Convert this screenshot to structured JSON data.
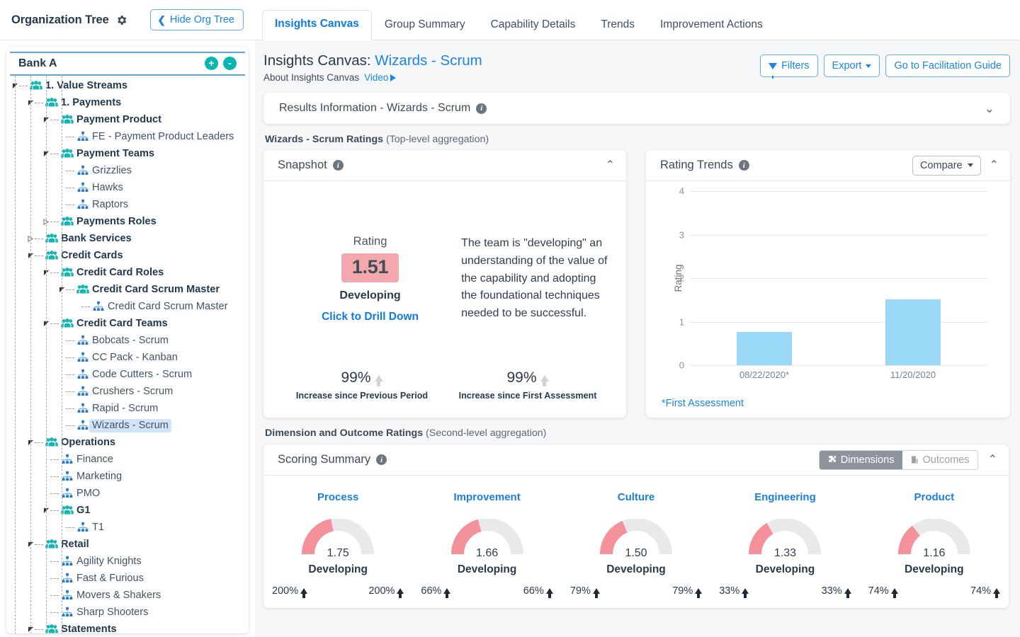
{
  "org_panel": {
    "title": "Organization Tree",
    "gear_icon": "gear-icon",
    "hide_button": "Hide Org Tree",
    "root": "Bank A",
    "expand_all": "+",
    "collapse_all": "-",
    "nodes": [
      {
        "label": "1. Value Streams",
        "depth": 1,
        "type": "group",
        "expanded": true,
        "selected": false
      },
      {
        "label": "1. Payments",
        "depth": 2,
        "type": "group",
        "expanded": true,
        "selected": false
      },
      {
        "label": "Payment Product",
        "depth": 3,
        "type": "group",
        "expanded": true,
        "selected": false
      },
      {
        "label": "FE - Payment Product Leaders",
        "depth": 4,
        "type": "team",
        "expanded": null,
        "selected": false
      },
      {
        "label": "Payment Teams",
        "depth": 3,
        "type": "group",
        "expanded": true,
        "selected": false
      },
      {
        "label": "Grizzlies",
        "depth": 4,
        "type": "team",
        "expanded": null,
        "selected": false
      },
      {
        "label": "Hawks",
        "depth": 4,
        "type": "team",
        "expanded": null,
        "selected": false
      },
      {
        "label": "Raptors",
        "depth": 4,
        "type": "team",
        "expanded": null,
        "selected": false
      },
      {
        "label": "Payments Roles",
        "depth": 3,
        "type": "group",
        "expanded": false,
        "selected": false
      },
      {
        "label": "Bank Services",
        "depth": 2,
        "type": "group",
        "expanded": false,
        "selected": false
      },
      {
        "label": "Credit Cards",
        "depth": 2,
        "type": "group",
        "expanded": true,
        "selected": false
      },
      {
        "label": "Credit Card Roles",
        "depth": 3,
        "type": "group",
        "expanded": true,
        "selected": false
      },
      {
        "label": "Credit Card Scrum Master",
        "depth": 4,
        "type": "group",
        "expanded": true,
        "selected": false
      },
      {
        "label": "Credit Card Scrum Master",
        "depth": 5,
        "type": "team",
        "expanded": null,
        "selected": false
      },
      {
        "label": "Credit Card Teams",
        "depth": 3,
        "type": "group",
        "expanded": true,
        "selected": false
      },
      {
        "label": "Bobcats - Scrum",
        "depth": 4,
        "type": "team",
        "expanded": null,
        "selected": false
      },
      {
        "label": "CC Pack - Kanban",
        "depth": 4,
        "type": "team",
        "expanded": null,
        "selected": false
      },
      {
        "label": "Code Cutters - Scrum",
        "depth": 4,
        "type": "team",
        "expanded": null,
        "selected": false
      },
      {
        "label": "Crushers - Scrum",
        "depth": 4,
        "type": "team",
        "expanded": null,
        "selected": false
      },
      {
        "label": "Rapid - Scrum",
        "depth": 4,
        "type": "team",
        "expanded": null,
        "selected": false
      },
      {
        "label": "Wizards - Scrum",
        "depth": 4,
        "type": "team",
        "expanded": null,
        "selected": true
      },
      {
        "label": "Operations",
        "depth": 2,
        "type": "group",
        "expanded": true,
        "selected": false
      },
      {
        "label": "Finance",
        "depth": 3,
        "type": "team",
        "expanded": null,
        "selected": false
      },
      {
        "label": "Marketing",
        "depth": 3,
        "type": "team",
        "expanded": null,
        "selected": false
      },
      {
        "label": "PMO",
        "depth": 3,
        "type": "team",
        "expanded": null,
        "selected": false
      },
      {
        "label": "G1",
        "depth": 3,
        "type": "group",
        "expanded": true,
        "selected": false
      },
      {
        "label": "T1",
        "depth": 4,
        "type": "team",
        "expanded": null,
        "selected": false
      },
      {
        "label": "Retail",
        "depth": 2,
        "type": "group",
        "expanded": true,
        "selected": false
      },
      {
        "label": "Agility Knights",
        "depth": 3,
        "type": "team",
        "expanded": null,
        "selected": false
      },
      {
        "label": "Fast & Furious",
        "depth": 3,
        "type": "team",
        "expanded": null,
        "selected": false
      },
      {
        "label": "Movers & Shakers",
        "depth": 3,
        "type": "team",
        "expanded": null,
        "selected": false
      },
      {
        "label": "Sharp Shooters",
        "depth": 3,
        "type": "team",
        "expanded": null,
        "selected": false
      },
      {
        "label": "Statements",
        "depth": 2,
        "type": "group",
        "expanded": true,
        "selected": false
      }
    ]
  },
  "tabs": [
    {
      "label": "Insights Canvas",
      "active": true
    },
    {
      "label": "Group Summary",
      "active": false
    },
    {
      "label": "Capability Details",
      "active": false
    },
    {
      "label": "Trends",
      "active": false
    },
    {
      "label": "Improvement Actions",
      "active": false
    }
  ],
  "header": {
    "title_prefix": "Insights Canvas:",
    "title_entity": "Wizards - Scrum",
    "about": "About Insights Canvas",
    "video": "Video",
    "filters_button": "Filters",
    "export_button": "Export",
    "facilitation_button": "Go to Facilitation Guide"
  },
  "results_info": {
    "label": "Results Information - Wizards - Scrum",
    "info_icon": "info-icon",
    "chevron": "⌄"
  },
  "ratings_section": {
    "label": "Wizards - Scrum Ratings",
    "sub": "(Top-level aggregation)"
  },
  "snapshot": {
    "title": "Snapshot",
    "rating_label": "Rating",
    "rating_value": "1.51",
    "rating_state": "Developing",
    "drill_link": "Click to Drill Down",
    "description": "The team is \"developing\" an understanding of the value of the capability and adopting the foundational techniques needed to be successful.",
    "stats": [
      {
        "value": "99%",
        "label": "Increase since Previous Period"
      },
      {
        "value": "99%",
        "label": "Increase since First Assessment"
      }
    ],
    "rating_badge_color": "#f4a7ac"
  },
  "trends": {
    "title": "Rating Trends",
    "compare_button": "Compare",
    "footnote": "*First Assessment"
  },
  "chart_data": {
    "type": "bar",
    "title": "Rating Trends",
    "categories": [
      "08/22/2020*",
      "11/20/2020"
    ],
    "values": [
      0.76,
      1.51
    ],
    "xlabel": "",
    "ylabel": "Rating",
    "ylim": [
      0,
      4
    ],
    "yticks": [
      0,
      1,
      2,
      3,
      4
    ],
    "grid": true,
    "legend": "none",
    "bar_color": "#9ad8f7"
  },
  "dimensions_section": {
    "label": "Dimension and Outcome Ratings",
    "sub": "(Second-level aggregation)"
  },
  "scoring": {
    "title": "Scoring Summary",
    "toggle": [
      {
        "label": "Dimensions",
        "icon": "puzzle-icon",
        "active": true
      },
      {
        "label": "Outcomes",
        "icon": "building-icon",
        "active": false
      }
    ],
    "gauge_fill_color": "#f4919b",
    "gauge_track_color": "#e9e9e9",
    "max": 4,
    "columns": [
      {
        "name": "Process",
        "value": "1.75",
        "score": 1.75,
        "state": "Developing",
        "pct_left": "200%",
        "pct_right": "200%"
      },
      {
        "name": "Improvement",
        "value": "1.66",
        "score": 1.66,
        "state": "Developing",
        "pct_left": "66%",
        "pct_right": "66%"
      },
      {
        "name": "Culture",
        "value": "1.50",
        "score": 1.5,
        "state": "Developing",
        "pct_left": "79%",
        "pct_right": "79%"
      },
      {
        "name": "Engineering",
        "value": "1.33",
        "score": 1.33,
        "state": "Developing",
        "pct_left": "33%",
        "pct_right": "33%"
      },
      {
        "name": "Product",
        "value": "1.16",
        "score": 1.16,
        "state": "Developing",
        "pct_left": "74%",
        "pct_right": "74%"
      }
    ]
  }
}
